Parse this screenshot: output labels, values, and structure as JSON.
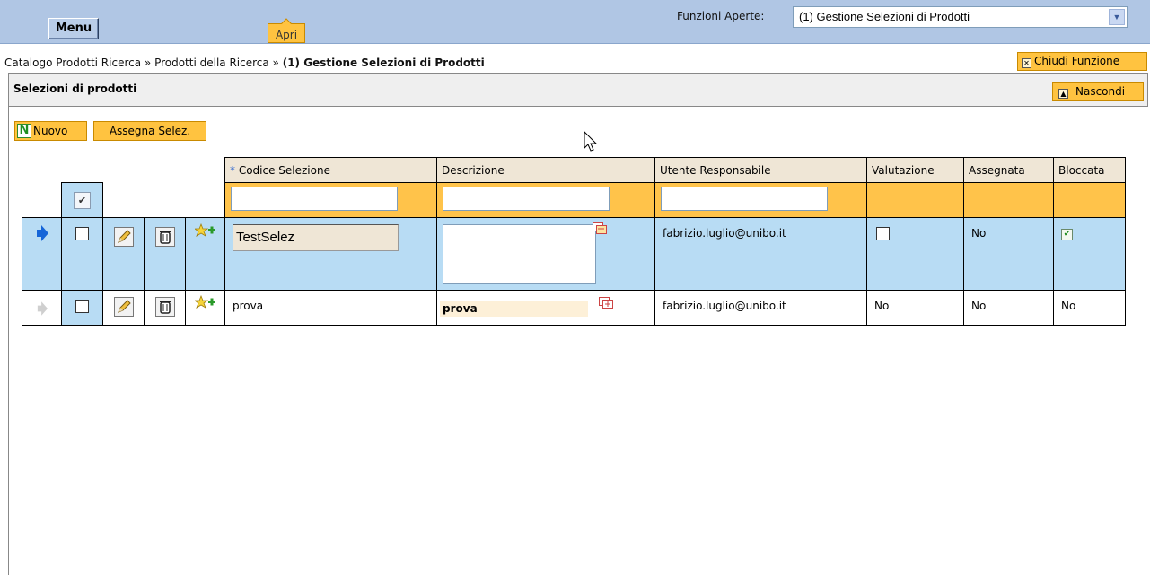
{
  "topbar": {
    "menu_label": "Menu",
    "apri_label": "Apri",
    "funzioni_label": "Funzioni Aperte:",
    "funzioni_selected": "(1) Gestione Selezioni di Prodotti"
  },
  "breadcrumb": {
    "part1": "Catalogo Prodotti Ricerca",
    "sep": " » ",
    "part2": "Prodotti della Ricerca",
    "current": "(1) Gestione Selezioni di Prodotti"
  },
  "chiudi_label": "Chiudi Funzione",
  "panel": {
    "title": "Selezioni di prodotti",
    "nascondi_label": "Nascondi"
  },
  "toolbar": {
    "nuovo_label": "Nuovo",
    "assegna_label": "Assegna Selez."
  },
  "table": {
    "headers": {
      "codice": "Codice Selezione",
      "codice_required_mark": "*",
      "descrizione": "Descrizione",
      "utente": "Utente Responsabile",
      "valutazione": "Valutazione",
      "assegnata": "Assegnata",
      "bloccata": "Bloccata"
    },
    "rows": [
      {
        "codice": "TestSelez",
        "descrizione": "",
        "utente": "fabrizio.luglio@unibo.it",
        "valutazione_checked": false,
        "assegnata": "No",
        "bloccata_checked": true,
        "editing": true
      },
      {
        "codice": "prova",
        "descrizione": "prova",
        "utente": "fabrizio.luglio@unibo.it",
        "valutazione": "No",
        "assegnata": "No",
        "bloccata": "No",
        "editing": false
      }
    ]
  },
  "colors": {
    "topbar": "#b0c6e4",
    "button_orange": "#ffc340",
    "header_beige": "#efe6d6",
    "selected_row": "#b8dcf4"
  }
}
